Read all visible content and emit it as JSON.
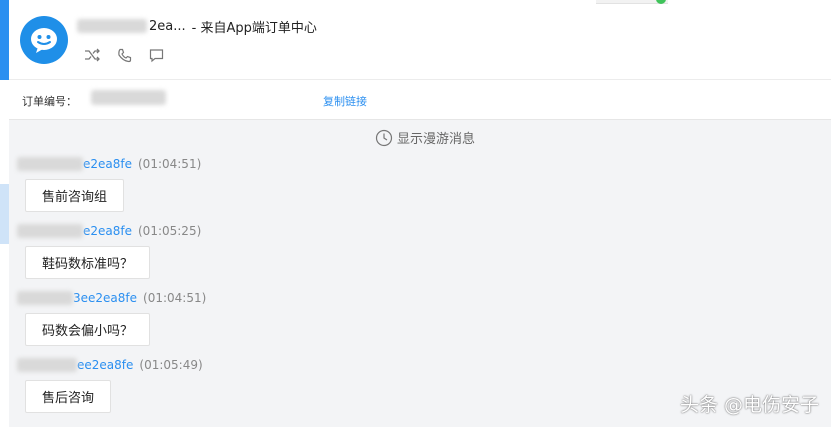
{
  "header": {
    "title_partial": "2ea...",
    "title_source": "- 来自App端订单中心"
  },
  "order": {
    "label": "订单编号：",
    "copy_link": "复制链接"
  },
  "chat": {
    "roaming_label": "显示漫游消息",
    "messages": [
      {
        "sender_suffix": "e2ea8fe",
        "time": "(01:04:51)",
        "text": "售前咨询组"
      },
      {
        "sender_suffix": "e2ea8fe",
        "time": "(01:05:25)",
        "text": "鞋码数标准吗？"
      },
      {
        "sender_suffix": "3ee2ea8fe",
        "time": "(01:04:51)",
        "text": "码数会偏小吗？"
      },
      {
        "sender_suffix": "ee2ea8fe",
        "time": "(01:05:49)",
        "text": "售后咨询"
      }
    ]
  },
  "watermark": "头条 @电伤安子",
  "colors": {
    "accent": "#2b8ff0",
    "chat_bg": "#f3f4f6",
    "avatar": "#1f8fe8"
  }
}
